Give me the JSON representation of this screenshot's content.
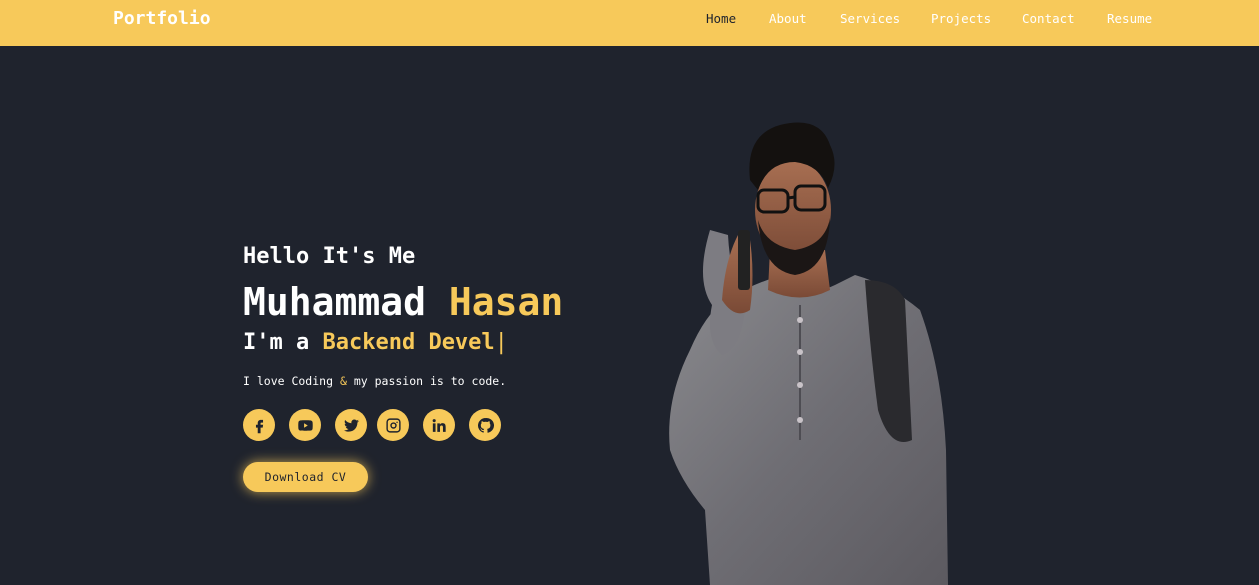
{
  "nav": {
    "brand": "Portfolio",
    "links": [
      {
        "label": "Home"
      },
      {
        "label": "About"
      },
      {
        "label": "Services"
      },
      {
        "label": "Projects"
      },
      {
        "label": "Contact"
      },
      {
        "label": "Resume"
      }
    ]
  },
  "hero": {
    "greeting": "Hello It's Me",
    "first_name": "Muhammad",
    "last_name": "Hasan",
    "role_prefix": "I'm a",
    "role_typed": "Backend Devel",
    "cursor": "|",
    "tagline_part1": "I love Coding",
    "tagline_amp": "&",
    "tagline_part2": "my passion is to code.",
    "cta_label": "Download CV"
  },
  "socials": [
    {
      "icon": "facebook-icon"
    },
    {
      "icon": "youtube-icon"
    },
    {
      "icon": "twitter-icon"
    },
    {
      "icon": "instagram-icon"
    },
    {
      "icon": "linkedin-icon"
    },
    {
      "icon": "github-icon"
    }
  ],
  "colors": {
    "accent": "#f7c95a",
    "background": "#1f232d",
    "text": "#ffffff"
  }
}
